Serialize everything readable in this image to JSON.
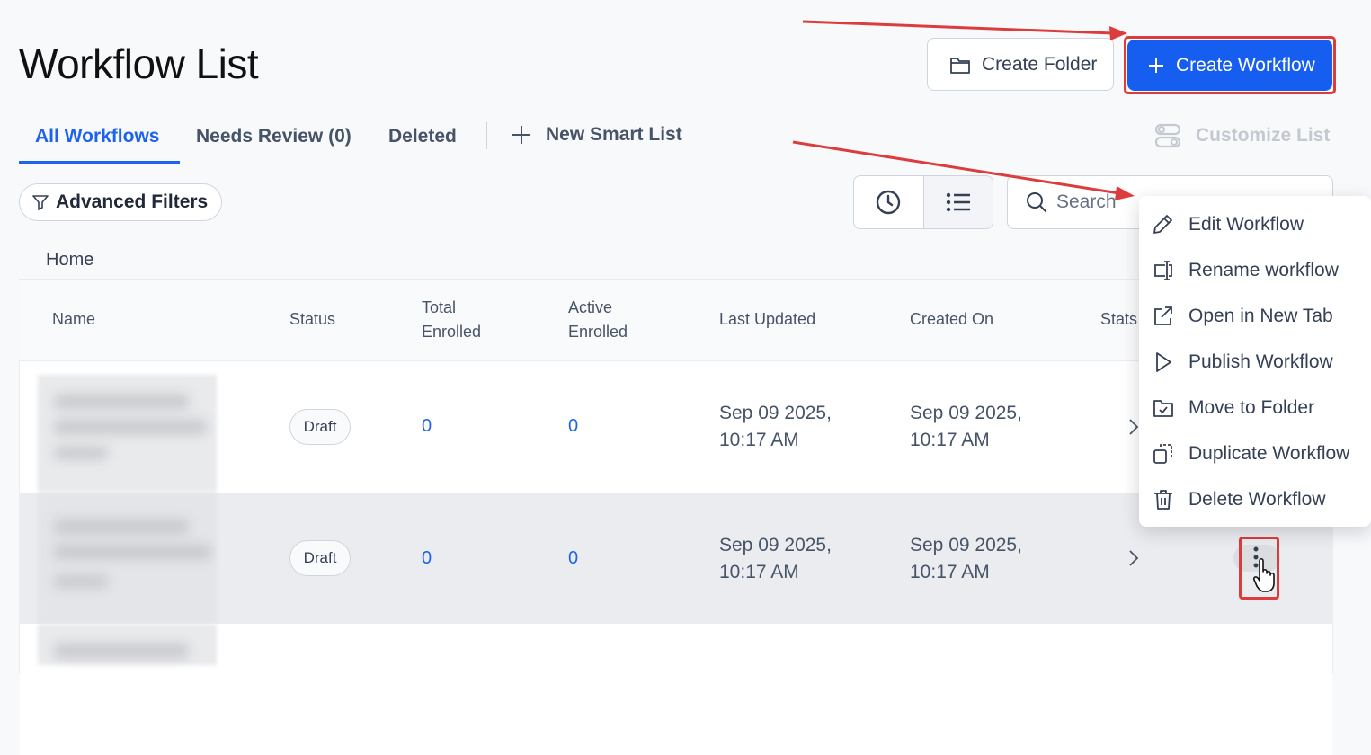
{
  "header": {
    "title": "Workflow List",
    "create_folder_label": "Create Folder",
    "create_workflow_label": "Create Workflow"
  },
  "tabs": [
    {
      "label": "All Workflows",
      "active": true
    },
    {
      "label": "Needs Review (0)",
      "active": false
    },
    {
      "label": "Deleted",
      "active": false
    }
  ],
  "new_smart_list_label": "New Smart List",
  "customize_label": "Customize List",
  "filters": {
    "advanced_label": "Advanced Filters",
    "search_placeholder": "Search"
  },
  "breadcrumb": {
    "home": "Home"
  },
  "table": {
    "columns": {
      "name": "Name",
      "status": "Status",
      "total_1": "Total",
      "total_2": "Enrolled",
      "active_1": "Active",
      "active_2": "Enrolled",
      "last_updated": "Last Updated",
      "created_on": "Created On",
      "stats": "Stats"
    },
    "rows": [
      {
        "status": "Draft",
        "total": "0",
        "active": "0",
        "updated_1": "Sep 09 2025,",
        "updated_2": "10:17 AM",
        "created_1": "Sep 09 2025,",
        "created_2": "10:17 AM"
      },
      {
        "status": "Draft",
        "total": "0",
        "active": "0",
        "updated_1": "Sep 09 2025,",
        "updated_2": "10:17 AM",
        "created_1": "Sep 09 2025,",
        "created_2": "10:17 AM"
      }
    ]
  },
  "context_menu": {
    "items": [
      {
        "label": "Edit Workflow",
        "icon": "pencil-icon"
      },
      {
        "label": "Rename workflow",
        "icon": "rename-icon"
      },
      {
        "label": "Open in New Tab",
        "icon": "external-link-icon"
      },
      {
        "label": "Publish Workflow",
        "icon": "play-icon"
      },
      {
        "label": "Move to Folder",
        "icon": "folder-check-icon"
      },
      {
        "label": "Duplicate Workflow",
        "icon": "duplicate-icon"
      },
      {
        "label": "Delete Workflow",
        "icon": "trash-icon"
      }
    ]
  },
  "colors": {
    "primary": "#155eef",
    "annotation_red": "#dc3c3c",
    "active_tab": "#1d63ed"
  }
}
